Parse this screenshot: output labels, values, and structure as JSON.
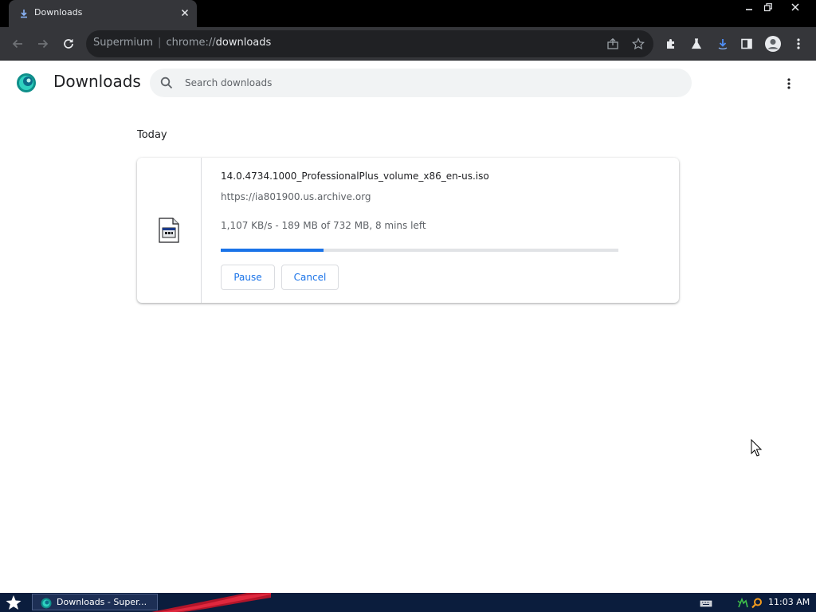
{
  "browser": {
    "tab": {
      "title": "Downloads"
    },
    "omnibox": {
      "app_name": "Supermium",
      "url_scheme": "chrome://",
      "url_path": "downloads"
    }
  },
  "page": {
    "title": "Downloads",
    "search": {
      "placeholder": "Search downloads",
      "value": ""
    }
  },
  "downloads": {
    "date_header": "Today",
    "items": [
      {
        "file_name": "14.0.4734.1000_ProfessionalPlus_volume_x86_en-us.iso",
        "url": "https://ia801900.us.archive.org",
        "status": "1,107 KB/s - 189 MB of 732 MB, 8 mins left",
        "progress_percent": 25.8,
        "buttons": {
          "pause": "Pause",
          "cancel": "Cancel"
        }
      }
    ]
  },
  "taskbar": {
    "task_label": "Downloads - Super...",
    "clock": "11:03 AM"
  },
  "colors": {
    "accent": "#1a73e8",
    "toolbar": "#35363a",
    "tabstrip": "#000000",
    "taskbar": "#0b1d3d"
  },
  "icons": [
    "download-icon",
    "close-icon",
    "minimize-icon",
    "restore-icon",
    "back-icon",
    "forward-icon",
    "reload-icon",
    "share-icon",
    "star-icon",
    "extensions-icon",
    "labs-icon",
    "downloads-toolbar-icon",
    "side-panel-icon",
    "profile-icon",
    "menu-icon",
    "search-icon",
    "file-icon",
    "start-icon"
  ]
}
